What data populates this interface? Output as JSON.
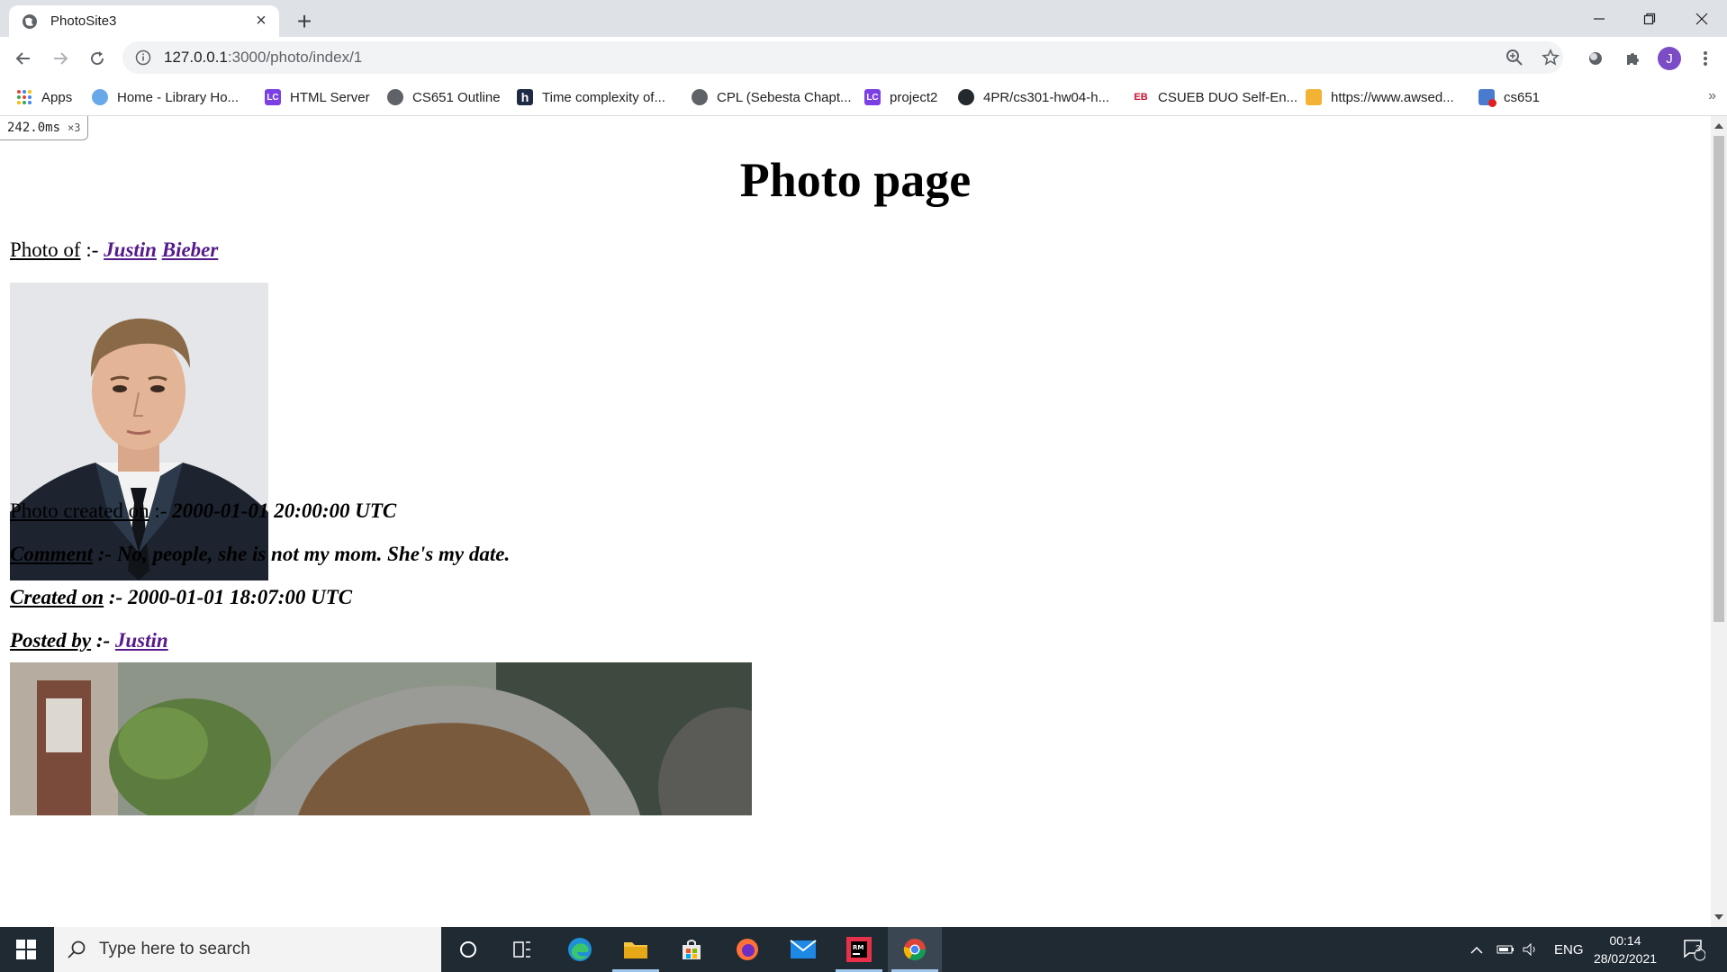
{
  "browser": {
    "tab_title": "PhotoSite3",
    "url_host": "127.0.0.1",
    "url_path": ":3000/photo/index/1",
    "avatar_letter": "J",
    "bookmarks": [
      {
        "label": "Apps",
        "icon": "apps-grid-icon"
      },
      {
        "label": "Home - Library Ho...",
        "icon": "cloud-icon"
      },
      {
        "label": "HTML Server",
        "icon": "lc-icon"
      },
      {
        "label": "CS651 Outline",
        "icon": "globe-icon"
      },
      {
        "label": "Time complexity of...",
        "icon": "h-icon"
      },
      {
        "label": "CPL (Sebesta Chapt...",
        "icon": "globe-icon"
      },
      {
        "label": "project2",
        "icon": "lc-icon"
      },
      {
        "label": "4PR/cs301-hw04-h...",
        "icon": "github-icon"
      },
      {
        "label": "CSUEB DUO Self-En...",
        "icon": "eb-icon"
      },
      {
        "label": "https://www.awsed...",
        "icon": "box-icon"
      },
      {
        "label": "cs651",
        "icon": "notification-icon"
      }
    ],
    "overflow_label": "»"
  },
  "page": {
    "perf_time": "242.0ms",
    "perf_mult": "×3",
    "title": "Photo page",
    "photo_of_label": "Photo of",
    "sep": " :- ",
    "first_name": "Justin",
    "last_name": "Bieber",
    "photo_created_label": "Photo created on",
    "photo_created_value": "2000-01-01 20:00:00 UTC",
    "comment_label": "Comment",
    "comment_value": "No, people, she is not my mom. She's my date.",
    "created_on_label": "Created on",
    "created_on_value": "2000-01-01 18:07:00 UTC",
    "posted_by_label": "Posted by",
    "posted_by_value": "Justin"
  },
  "taskbar": {
    "search_placeholder": "Type here to search",
    "language": "ENG",
    "time": "00:14",
    "date": "28/02/2021",
    "notifications": "3"
  }
}
